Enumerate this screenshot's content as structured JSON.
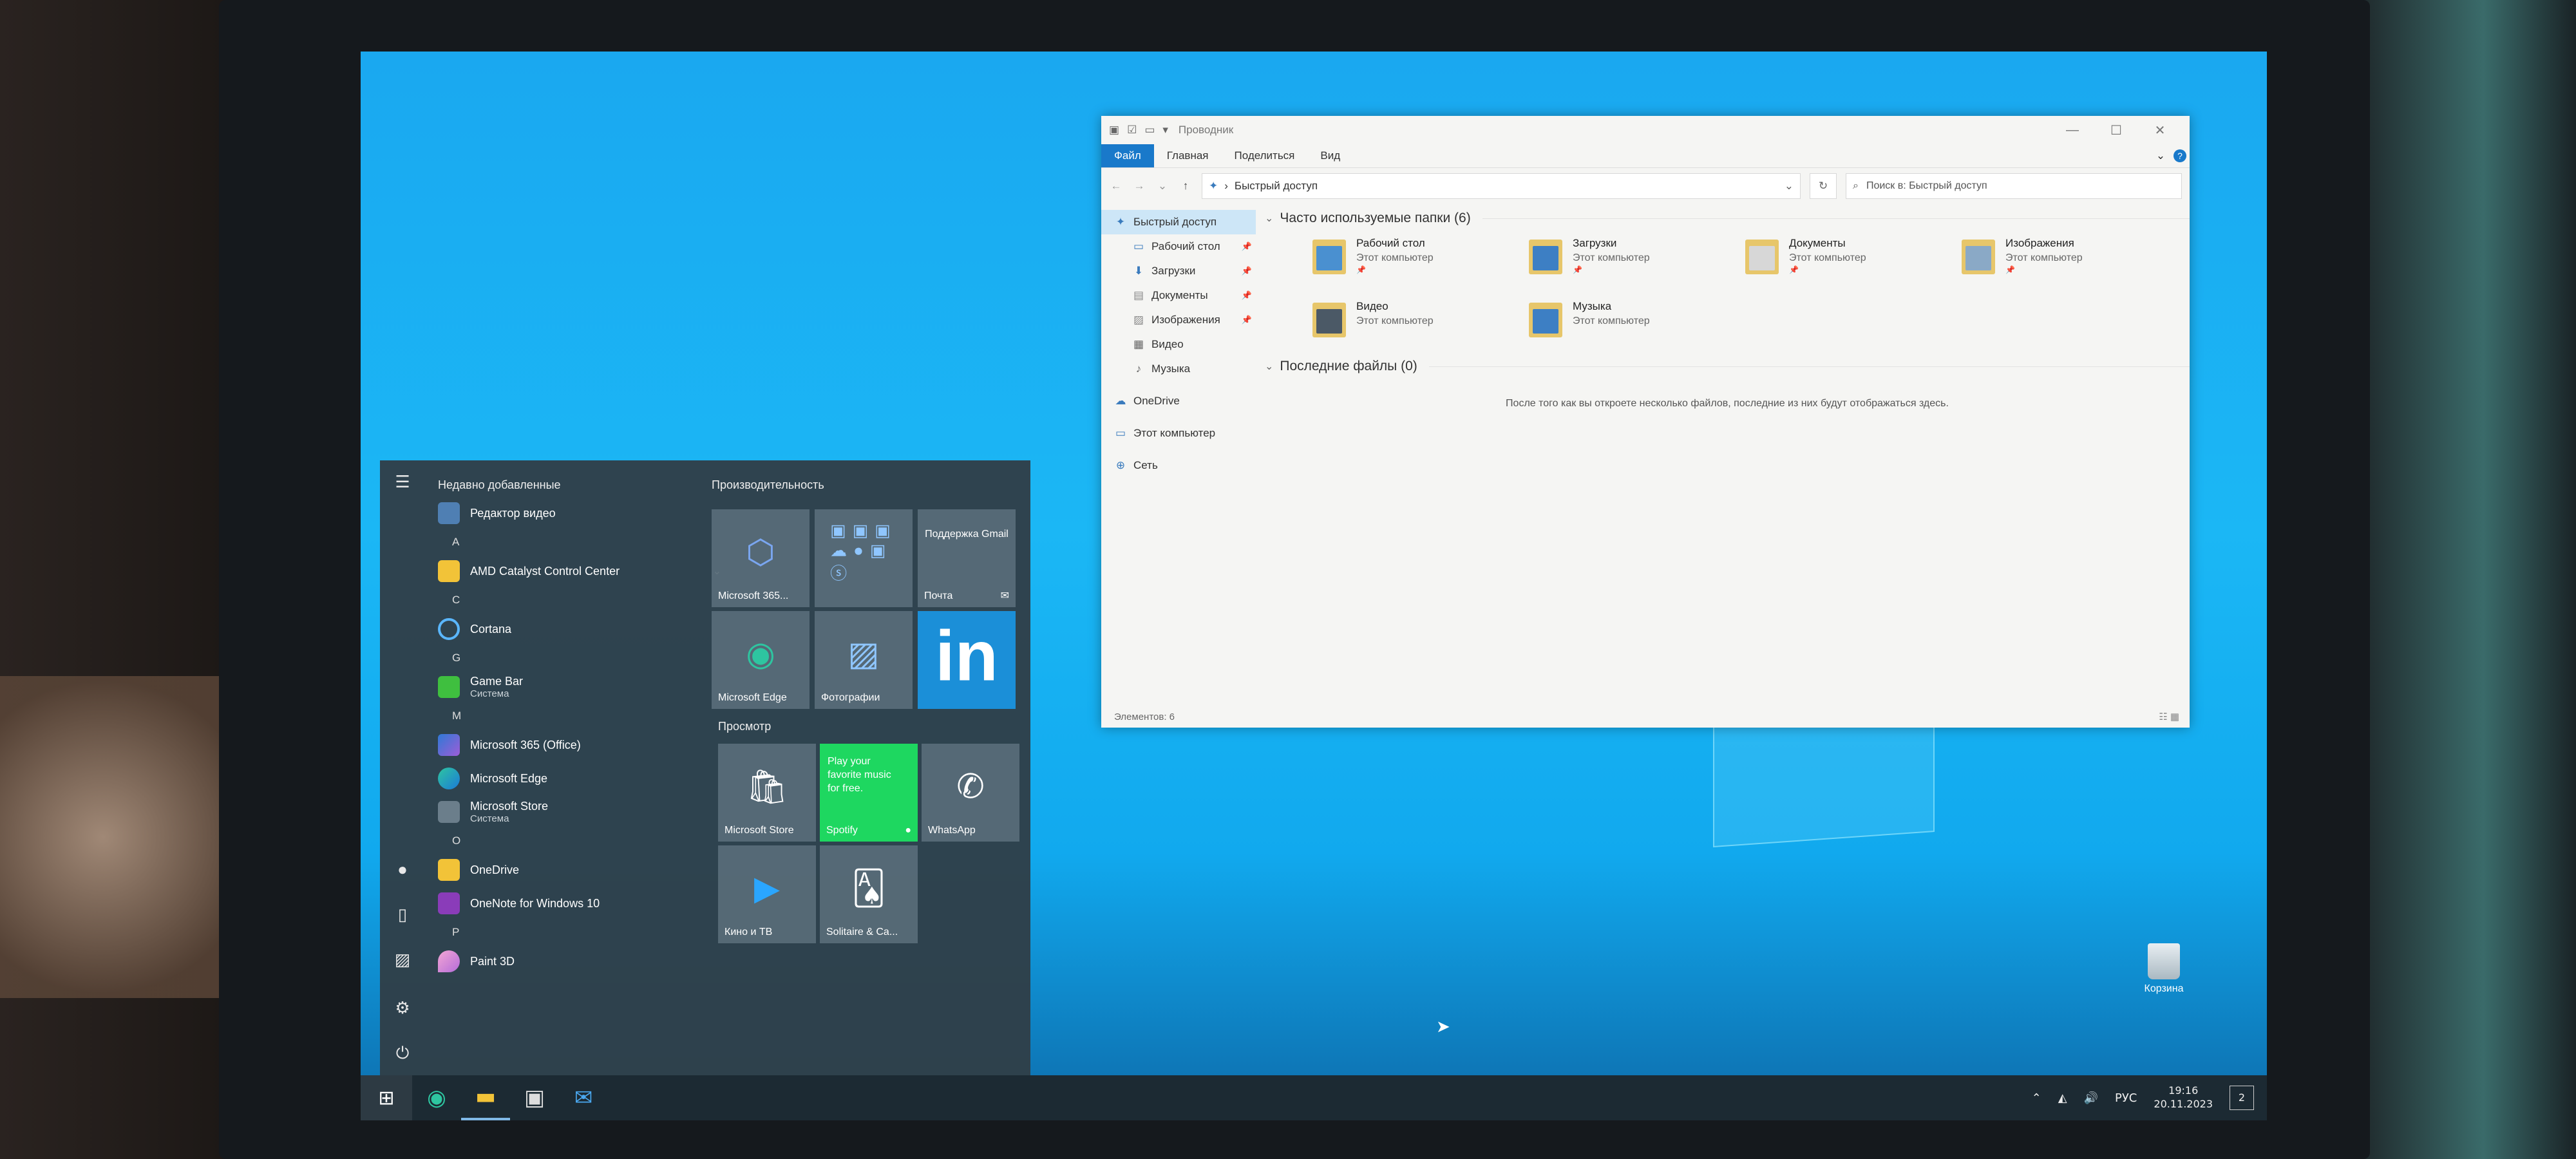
{
  "explorer": {
    "title": "Проводник",
    "tabs": [
      "Файл",
      "Главная",
      "Поделиться",
      "Вид"
    ],
    "address": "Быстрый доступ",
    "search_placeholder": "Поиск в: Быстрый доступ",
    "nav": {
      "quick_access": "Быстрый доступ",
      "pinned": [
        "Рабочий стол",
        "Загрузки",
        "Документы",
        "Изображения"
      ],
      "unpinned": [
        "Видео",
        "Музыка"
      ],
      "onedrive": "OneDrive",
      "this_pc": "Этот компьютер",
      "network": "Сеть"
    },
    "frequent_header": "Часто используемые папки (6)",
    "folders": [
      {
        "name": "Рабочий стол",
        "location": "Этот компьютер"
      },
      {
        "name": "Загрузки",
        "location": "Этот компьютер"
      },
      {
        "name": "Документы",
        "location": "Этот компьютер"
      },
      {
        "name": "Изображения",
        "location": "Этот компьютер"
      },
      {
        "name": "Видео",
        "location": "Этот компьютер"
      },
      {
        "name": "Музыка",
        "location": "Этот компьютер"
      }
    ],
    "recent_header": "Последние файлы (0)",
    "recent_empty": "После того как вы откроете несколько файлов, последние из них будут отображаться здесь.",
    "status": "Элементов: 6"
  },
  "start": {
    "recent_header": "Недавно добавленные",
    "recent_app": "Редактор видео",
    "letters": [
      "A",
      "C",
      "G",
      "M",
      "O",
      "P"
    ],
    "apps": {
      "amd": "AMD Catalyst Control Center",
      "cortana": "Cortana",
      "gamebar": "Game Bar",
      "gamebar_sub": "Система",
      "m365": "Microsoft 365 (Office)",
      "edge": "Microsoft Edge",
      "store": "Microsoft Store",
      "store_sub": "Система",
      "onedrive": "OneDrive",
      "onenote": "OneNote for Windows 10",
      "paint3d": "Paint 3D"
    },
    "productivity_header": "Производительность",
    "browse_header": "Просмотр",
    "tiles": {
      "m365": "Microsoft 365...",
      "gmail": "Поддержка Gmail",
      "mail": "Почта",
      "edge": "Microsoft Edge",
      "photos": "Фотографии",
      "store": "Microsoft Store",
      "spotify_promo": "Play your favorite music for free.",
      "spotify": "Spotify",
      "whatsapp": "WhatsApp",
      "movies": "Кино и ТВ",
      "solitaire": "Solitaire & Ca..."
    }
  },
  "taskbar": {
    "lang": "РУС",
    "time": "19:16",
    "date": "20.11.2023",
    "notifications": "2"
  },
  "desktop": {
    "recycle_bin": "Корзина"
  }
}
